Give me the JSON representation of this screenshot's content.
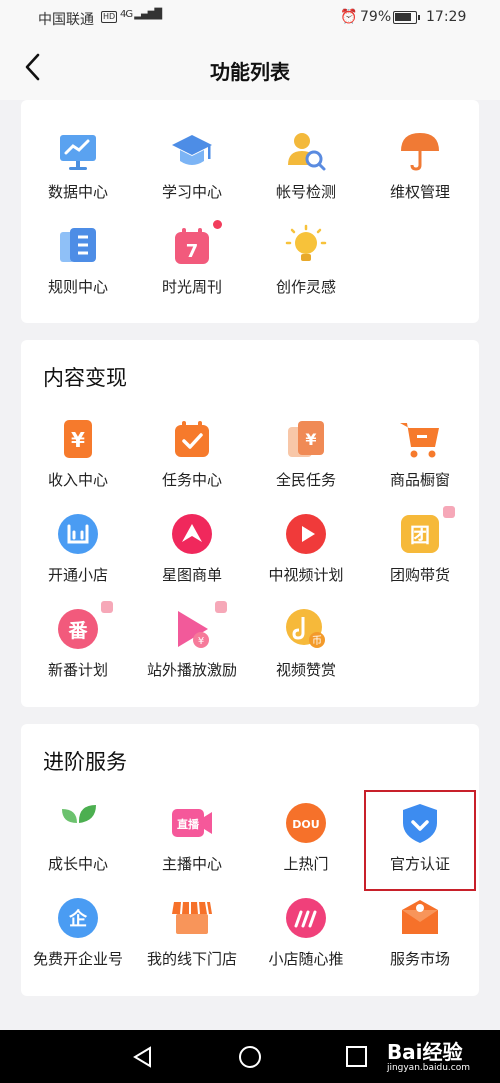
{
  "status": {
    "carrier": "中国联通",
    "hd": "HD",
    "signal": "4G",
    "battery": "79%",
    "time": "17:29"
  },
  "nav": {
    "title": "功能列表"
  },
  "tools": [
    {
      "label": "数据中心",
      "icon": "data-chart-icon"
    },
    {
      "label": "学习中心",
      "icon": "graduation-cap-icon"
    },
    {
      "label": "帐号检测",
      "icon": "account-check-icon"
    },
    {
      "label": "维权管理",
      "icon": "umbrella-icon"
    },
    {
      "label": "规则中心",
      "icon": "rules-book-icon"
    },
    {
      "label": "时光周刊",
      "icon": "calendar-7-icon"
    },
    {
      "label": "创作灵感",
      "icon": "lightbulb-icon"
    }
  ],
  "monetization": {
    "title": "内容变现",
    "items": [
      {
        "label": "收入中心",
        "icon": "income-yuan-icon"
      },
      {
        "label": "任务中心",
        "icon": "task-check-icon"
      },
      {
        "label": "全民任务",
        "icon": "public-task-icon"
      },
      {
        "label": "商品橱窗",
        "icon": "shopping-cart-icon"
      },
      {
        "label": "开通小店",
        "icon": "shop-icon"
      },
      {
        "label": "星图商单",
        "icon": "star-map-icon"
      },
      {
        "label": "中视频计划",
        "icon": "video-play-icon"
      },
      {
        "label": "团购带货",
        "icon": "group-buy-icon"
      },
      {
        "label": "新番计划",
        "icon": "anime-icon"
      },
      {
        "label": "站外播放激励",
        "icon": "offsite-play-icon"
      },
      {
        "label": "视频赞赏",
        "icon": "video-reward-icon"
      }
    ]
  },
  "advanced": {
    "title": "进阶服务",
    "items": [
      {
        "label": "成长中心",
        "icon": "sprout-icon"
      },
      {
        "label": "主播中心",
        "icon": "live-camera-icon"
      },
      {
        "label": "上热门",
        "icon": "dou-plus-icon"
      },
      {
        "label": "官方认证",
        "icon": "verified-shield-icon"
      },
      {
        "label": "免费开企业号",
        "icon": "enterprise-icon"
      },
      {
        "label": "我的线下门店",
        "icon": "storefront-icon"
      },
      {
        "label": "小店随心推",
        "icon": "shop-promote-icon"
      },
      {
        "label": "服务市场",
        "icon": "service-market-icon"
      }
    ]
  },
  "watermark": {
    "brand": "Bai经验",
    "url": "jingyan.baidu.com"
  },
  "colors": {
    "highlight": "#c8202a",
    "accent_red": "#f23d5c",
    "card_bg": "#ffffff",
    "page_bg": "#f2f2f4"
  }
}
